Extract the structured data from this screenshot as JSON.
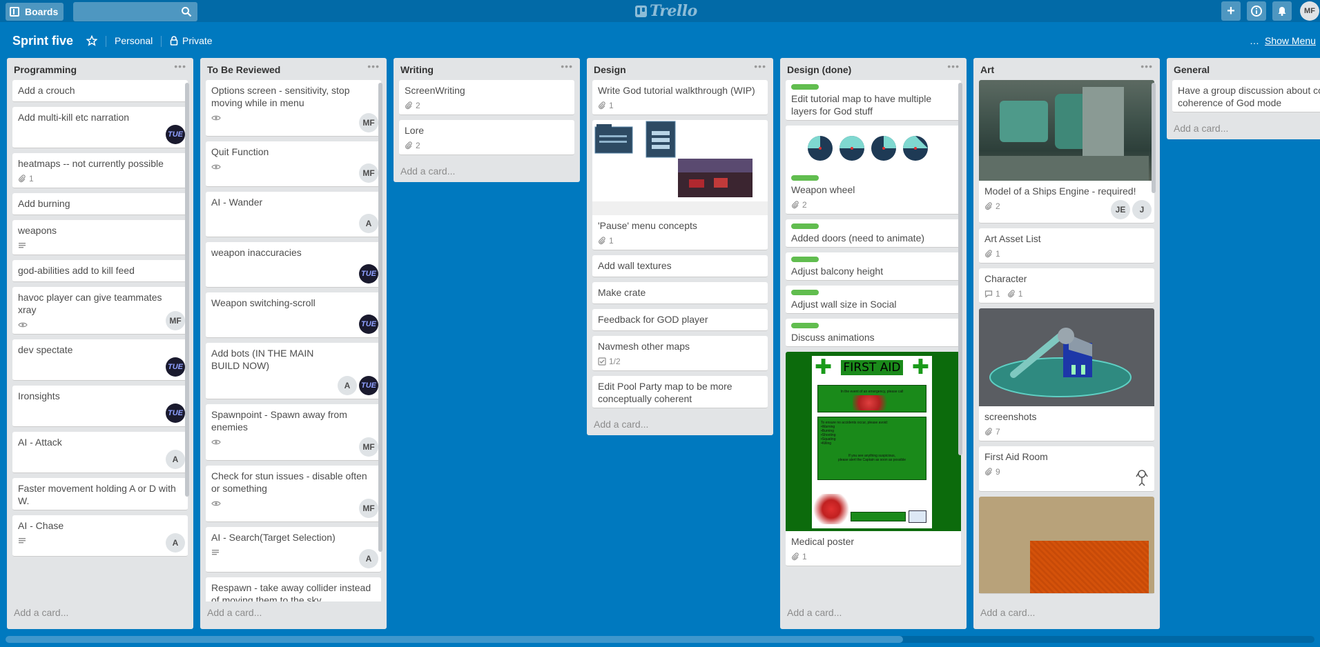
{
  "header": {
    "boards_label": "Boards",
    "search_placeholder": "",
    "logo_text": "Trello",
    "avatar_initials": "MF"
  },
  "board": {
    "title": "Sprint five",
    "team": "Personal",
    "visibility": "Private",
    "show_menu": "Show Menu",
    "menu_dots": "…"
  },
  "colors": {
    "background": "#0079bf",
    "header": "#026aa7",
    "label_green": "#61bd4f"
  },
  "lists": [
    {
      "title": "Programming",
      "add_card": "Add a card...",
      "cards": [
        {
          "title": "Add a crouch"
        },
        {
          "title": "Add multi-kill etc narration",
          "members": [
            "TUE"
          ]
        },
        {
          "title": "heatmaps -- not currently possible",
          "attachments": "1"
        },
        {
          "title": "Add burning"
        },
        {
          "title": "weapons",
          "description_icon": true
        },
        {
          "title": "god-abilities add to kill feed"
        },
        {
          "title": "havoc player can give teammates xray",
          "watch_icon": true,
          "members": [
            "MF"
          ]
        },
        {
          "title": "dev spectate",
          "members": [
            "TUE"
          ]
        },
        {
          "title": "Ironsights",
          "members": [
            "TUE"
          ]
        },
        {
          "title": "AI - Attack",
          "members": [
            "A"
          ]
        },
        {
          "title": "Faster movement holding A or D with W."
        },
        {
          "title": "AI - Chase",
          "description_icon": true,
          "members": [
            "A"
          ]
        }
      ]
    },
    {
      "title": "To Be Reviewed",
      "add_card": "Add a card...",
      "cards": [
        {
          "title": "Options screen - sensitivity, stop moving while in menu",
          "watch_icon": true,
          "members": [
            "MF"
          ]
        },
        {
          "title": "Quit Function",
          "watch_icon": true,
          "members": [
            "MF"
          ]
        },
        {
          "title": "AI - Wander",
          "members": [
            "A"
          ]
        },
        {
          "title": "weapon inaccuracies",
          "members": [
            "TUE"
          ]
        },
        {
          "title": "Weapon switching-scroll",
          "members": [
            "TUE"
          ]
        },
        {
          "title": "Add bots (IN THE MAIN BUILD NOW)",
          "members": [
            "A",
            "TUE"
          ]
        },
        {
          "title": "Spawnpoint - Spawn away from enemies",
          "watch_icon": true,
          "members": [
            "MF"
          ]
        },
        {
          "title": "Check for stun issues - disable often or something",
          "watch_icon": true,
          "members": [
            "MF"
          ]
        },
        {
          "title": "AI - Search(Target Selection)",
          "description_icon": true,
          "members": [
            "A"
          ]
        },
        {
          "title": "Respawn - take away collider instead of moving them to the sky"
        }
      ]
    },
    {
      "title": "Writing",
      "add_card": "Add a card...",
      "cards": [
        {
          "title": "ScreenWriting",
          "attachments": "2"
        },
        {
          "title": "Lore",
          "attachments": "2"
        }
      ]
    },
    {
      "title": "Design",
      "add_card": "Add a card...",
      "cards": [
        {
          "title": "Write God tutorial walkthrough (WIP)",
          "attachments": "1"
        },
        {
          "title": "'Pause' menu concepts",
          "attachments": "1",
          "cover": "menu-concepts"
        },
        {
          "title": "Add wall textures"
        },
        {
          "title": "Make crate"
        },
        {
          "title": "Feedback for GOD player"
        },
        {
          "title": "Navmesh other maps",
          "checklist": "1/2"
        },
        {
          "title": "Edit Pool Party map to be more conceptually coherent"
        }
      ]
    },
    {
      "title": "Design (done)",
      "add_card": "Add a card...",
      "cards": [
        {
          "title": "Edit tutorial map to have multiple layers for God stuff",
          "label": true
        },
        {
          "title": "Weapon wheel",
          "attachments": "2",
          "label": true,
          "cover": "wheels"
        },
        {
          "title": "Added doors (need to animate)",
          "label": true
        },
        {
          "title": "Adjust balcony height",
          "label": true
        },
        {
          "title": "Adjust wall size in Social",
          "label": true
        },
        {
          "title": "Discuss animations",
          "label": true
        },
        {
          "title": "Medical poster",
          "attachments": "1",
          "cover": "first-aid"
        }
      ],
      "poster": {
        "heading": "FIRST AID",
        "line1": "In the event of an emergency, please call",
        "line2": "To ensure no accidents occur, please avoid:",
        "items": [
          "•Warning",
          "•Burning",
          "•Shooting",
          "•Squating",
          "•Killing"
        ],
        "line3": "If you see anything suspicious,",
        "line4": "please alert the Captain as soon as possible"
      }
    },
    {
      "title": "Art",
      "add_card": "Add a card...",
      "cards": [
        {
          "title": "Model of a Ships Engine - required!",
          "attachments": "2",
          "members": [
            "JE",
            "J"
          ],
          "cover": "engine"
        },
        {
          "title": "Art Asset List",
          "attachments": "1"
        },
        {
          "title": "Character",
          "comments": "1",
          "attachments": "1"
        },
        {
          "title": "screenshots",
          "attachments": "7",
          "cover": "screenshot3d"
        },
        {
          "title": "First Aid Room",
          "attachments": "9",
          "members": [
            "sketch"
          ]
        },
        {
          "title": "",
          "cover": "texture"
        }
      ]
    },
    {
      "title": "General",
      "add_card": "Add a card...",
      "cards": [
        {
          "title": "Have a group discussion about conceptual coherence of God mode"
        }
      ]
    }
  ]
}
